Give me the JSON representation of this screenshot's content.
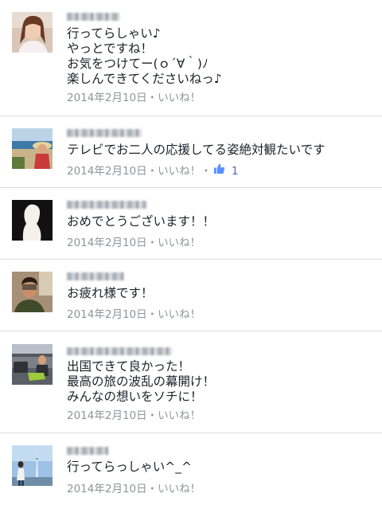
{
  "comments": [
    {
      "text": "行ってらしゃい♪\nやっとですね！\nお気をつけてー(ｏ´∀｀)ﾉ\n楽しんできてくださいねっ♪",
      "date": "2014年2月10日",
      "sep": "・",
      "like": "いいね！",
      "avatar": "woman-portrait-avatar"
    },
    {
      "text": "テレビでお二人の応援してる姿絶対観たいです",
      "date": "2014年2月10日",
      "sep": "・",
      "like": "いいね！",
      "like_count": "1",
      "avatar": "beach-hat-avatar"
    },
    {
      "text": "おめでとうございます！！",
      "date": "2014年2月10日",
      "sep": "・",
      "like": "いいね！",
      "avatar": "silhouette-avatar"
    },
    {
      "text": "お疲れ様です！",
      "date": "2014年2月10日",
      "sep": "・",
      "like": "いいね！",
      "avatar": "man-portrait-avatar"
    },
    {
      "text": "出国できて良かった！\n最高の旅の波乱の幕開け！\nみんなの想いをソチに！",
      "date": "2014年2月10日",
      "sep": "・",
      "like": "いいね！",
      "avatar": "lounge-avatar"
    },
    {
      "text": "行ってらっしゃい^_^",
      "date": "2014年2月10日",
      "sep": "・",
      "like": "いいね！",
      "avatar": "skytree-avatar"
    }
  ],
  "colors": {
    "meta": "#90949c",
    "like_count": "#4e69a2",
    "divider": "#d9dce2"
  }
}
